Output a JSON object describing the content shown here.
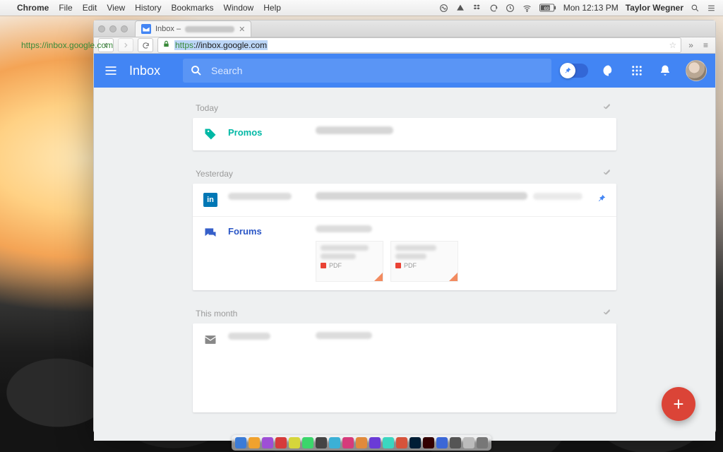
{
  "mac_menubar": {
    "app": "Chrome",
    "menus": [
      "File",
      "Edit",
      "View",
      "History",
      "Bookmarks",
      "Window",
      "Help"
    ],
    "battery_label": "69",
    "clock": "Mon 12:13 PM",
    "user": "Taylor Wegner"
  },
  "overlay_url": "https://inbox.google.com",
  "browser": {
    "tab_title": "Inbox –",
    "url_proto": "https",
    "url_rest": "://inbox.google.com"
  },
  "app": {
    "title": "Inbox",
    "search_placeholder": "Search"
  },
  "sections": {
    "today": {
      "label": "Today"
    },
    "yesterday": {
      "label": "Yesterday"
    },
    "this_month": {
      "label": "This month"
    }
  },
  "bundles": {
    "promos": "Promos",
    "forums": "Forums"
  },
  "attach": {
    "pdf": "PDF"
  },
  "fab": {
    "plus": "+"
  }
}
